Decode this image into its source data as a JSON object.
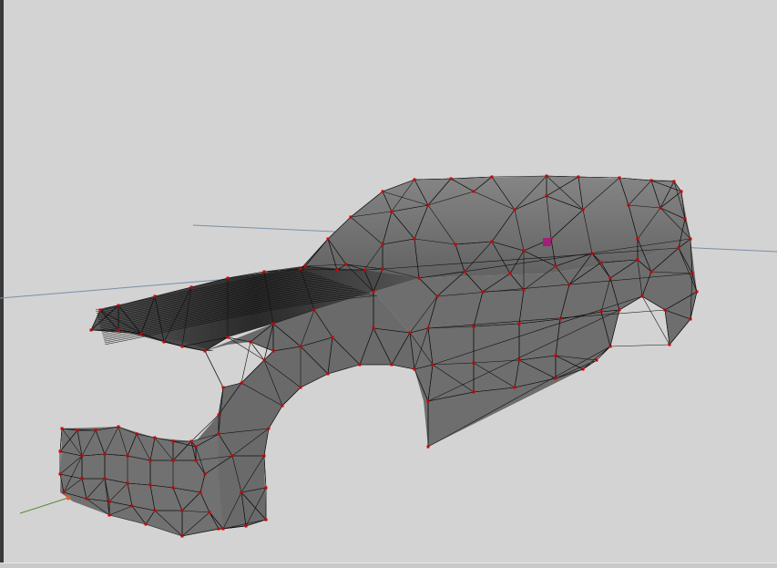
{
  "viewport": {
    "background": "#d3d3d3",
    "mesh_fill": "#6b6b6b",
    "mesh_fill_light": "#7c7c7c",
    "mesh_fill_dark": "#4a4a4a",
    "edge_color": "#111111",
    "vertex_color": "#cc0000",
    "selected_vertex_color": "#a0207a",
    "axis_x_color": "#7a8ea8",
    "axis_origin_color": "#e06030",
    "axis_green_color": "#5a8a3a"
  }
}
